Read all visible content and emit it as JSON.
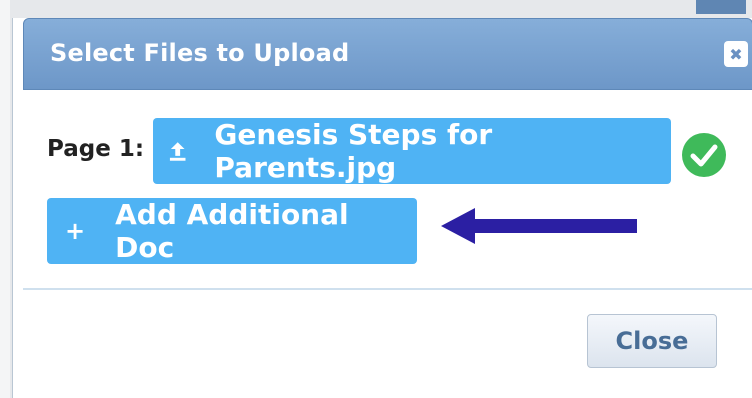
{
  "dialog": {
    "title": "Select Files to Upload",
    "close_icon": "close-x-icon",
    "page_label": "Page 1:",
    "file_button_label": "Genesis Steps for Parents.jpg",
    "upload_icon": "upload-icon",
    "status_icon": "check-circle-icon",
    "add_button_label": "Add Additional Doc",
    "add_icon_text": "+",
    "close_button_label": "Close"
  },
  "colors": {
    "titlebar": "#7aa3d1",
    "primary_button": "#4fb3f4",
    "success": "#3fba5a",
    "annotation_arrow": "#2b1fa3"
  }
}
